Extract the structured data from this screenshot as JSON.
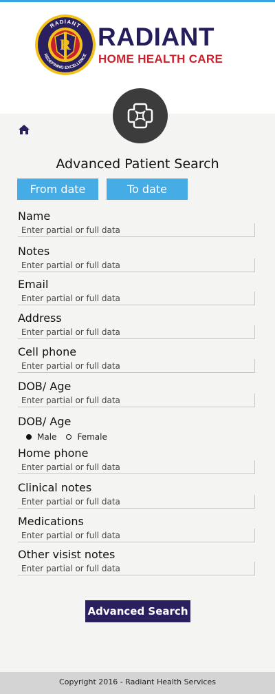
{
  "brand": {
    "name": "RADIANT",
    "tagline": "HOME HEALTH CARE",
    "seal_top_text": "RADIANT",
    "seal_bottom_text": "REDEFINING EXCELLENCE",
    "seal_letter": "R"
  },
  "colors": {
    "accent_blue": "#45ace6",
    "top_bar": "#3aa3e3",
    "navy": "#2a2060",
    "brand_red": "#c8202c",
    "badge_bg": "#3c3c3c"
  },
  "icons": {
    "center_badge": "medical-cross-icon",
    "home": "home-icon"
  },
  "page": {
    "title": "Advanced Patient Search"
  },
  "date_buttons": {
    "from": "From date",
    "to": "To date"
  },
  "fields": [
    {
      "label": "Name",
      "placeholder": "Enter partial or full data"
    },
    {
      "label": "Notes",
      "placeholder": "Enter partial or full data"
    },
    {
      "label": "Email",
      "placeholder": "Enter partial or full data"
    },
    {
      "label": "Address",
      "placeholder": "Enter partial or full data"
    },
    {
      "label": "Cell phone",
      "placeholder": "Enter partial or full data"
    },
    {
      "label": "DOB/ Age",
      "placeholder": "Enter partial or full data"
    }
  ],
  "gender": {
    "label": "DOB/ Age",
    "options": [
      {
        "label": "Male",
        "selected": true
      },
      {
        "label": "Female",
        "selected": false
      }
    ]
  },
  "fields_after": [
    {
      "label": "Home phone",
      "placeholder": "Enter partial or full data"
    },
    {
      "label": "Clinical notes",
      "placeholder": "Enter partial or full data"
    },
    {
      "label": "Medications",
      "placeholder": "Enter partial or full data"
    },
    {
      "label": "Other visist notes",
      "placeholder": "Enter partial or full data"
    }
  ],
  "submit": {
    "label": "Advanced Search"
  },
  "footer": {
    "copyright": "Copyright 2016 - Radiant Health Services"
  }
}
